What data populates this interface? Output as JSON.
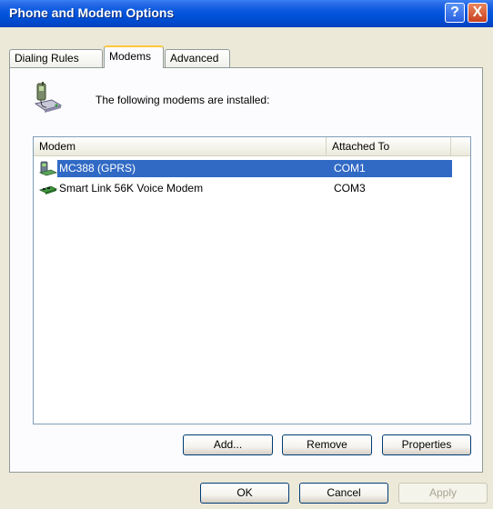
{
  "window": {
    "title": "Phone and Modem Options",
    "help_glyph": "?",
    "close_glyph": "X",
    "colors": {
      "titlebar": "#0052D9",
      "face": "#ECE9D8",
      "selection": "#316AC5"
    }
  },
  "tabs": [
    {
      "label": "Dialing Rules",
      "selected": false
    },
    {
      "label": "Modems",
      "selected": true
    },
    {
      "label": "Advanced",
      "selected": false
    }
  ],
  "content": {
    "header_icon": "phone-modem-icon",
    "header_text": "The following modems are installed:"
  },
  "list": {
    "columns": [
      "Modem",
      "Attached To"
    ],
    "rows": [
      {
        "name": "MC388 (GPRS)",
        "port": "COM1",
        "icon": "gprs-modem-icon",
        "selected": true
      },
      {
        "name": "Smart Link 56K Voice Modem",
        "port": "COM3",
        "icon": "modem-card-icon",
        "selected": false
      }
    ]
  },
  "buttons": {
    "add": "Add...",
    "remove": "Remove",
    "properties": "Properties",
    "ok": "OK",
    "cancel": "Cancel",
    "apply": "Apply"
  }
}
